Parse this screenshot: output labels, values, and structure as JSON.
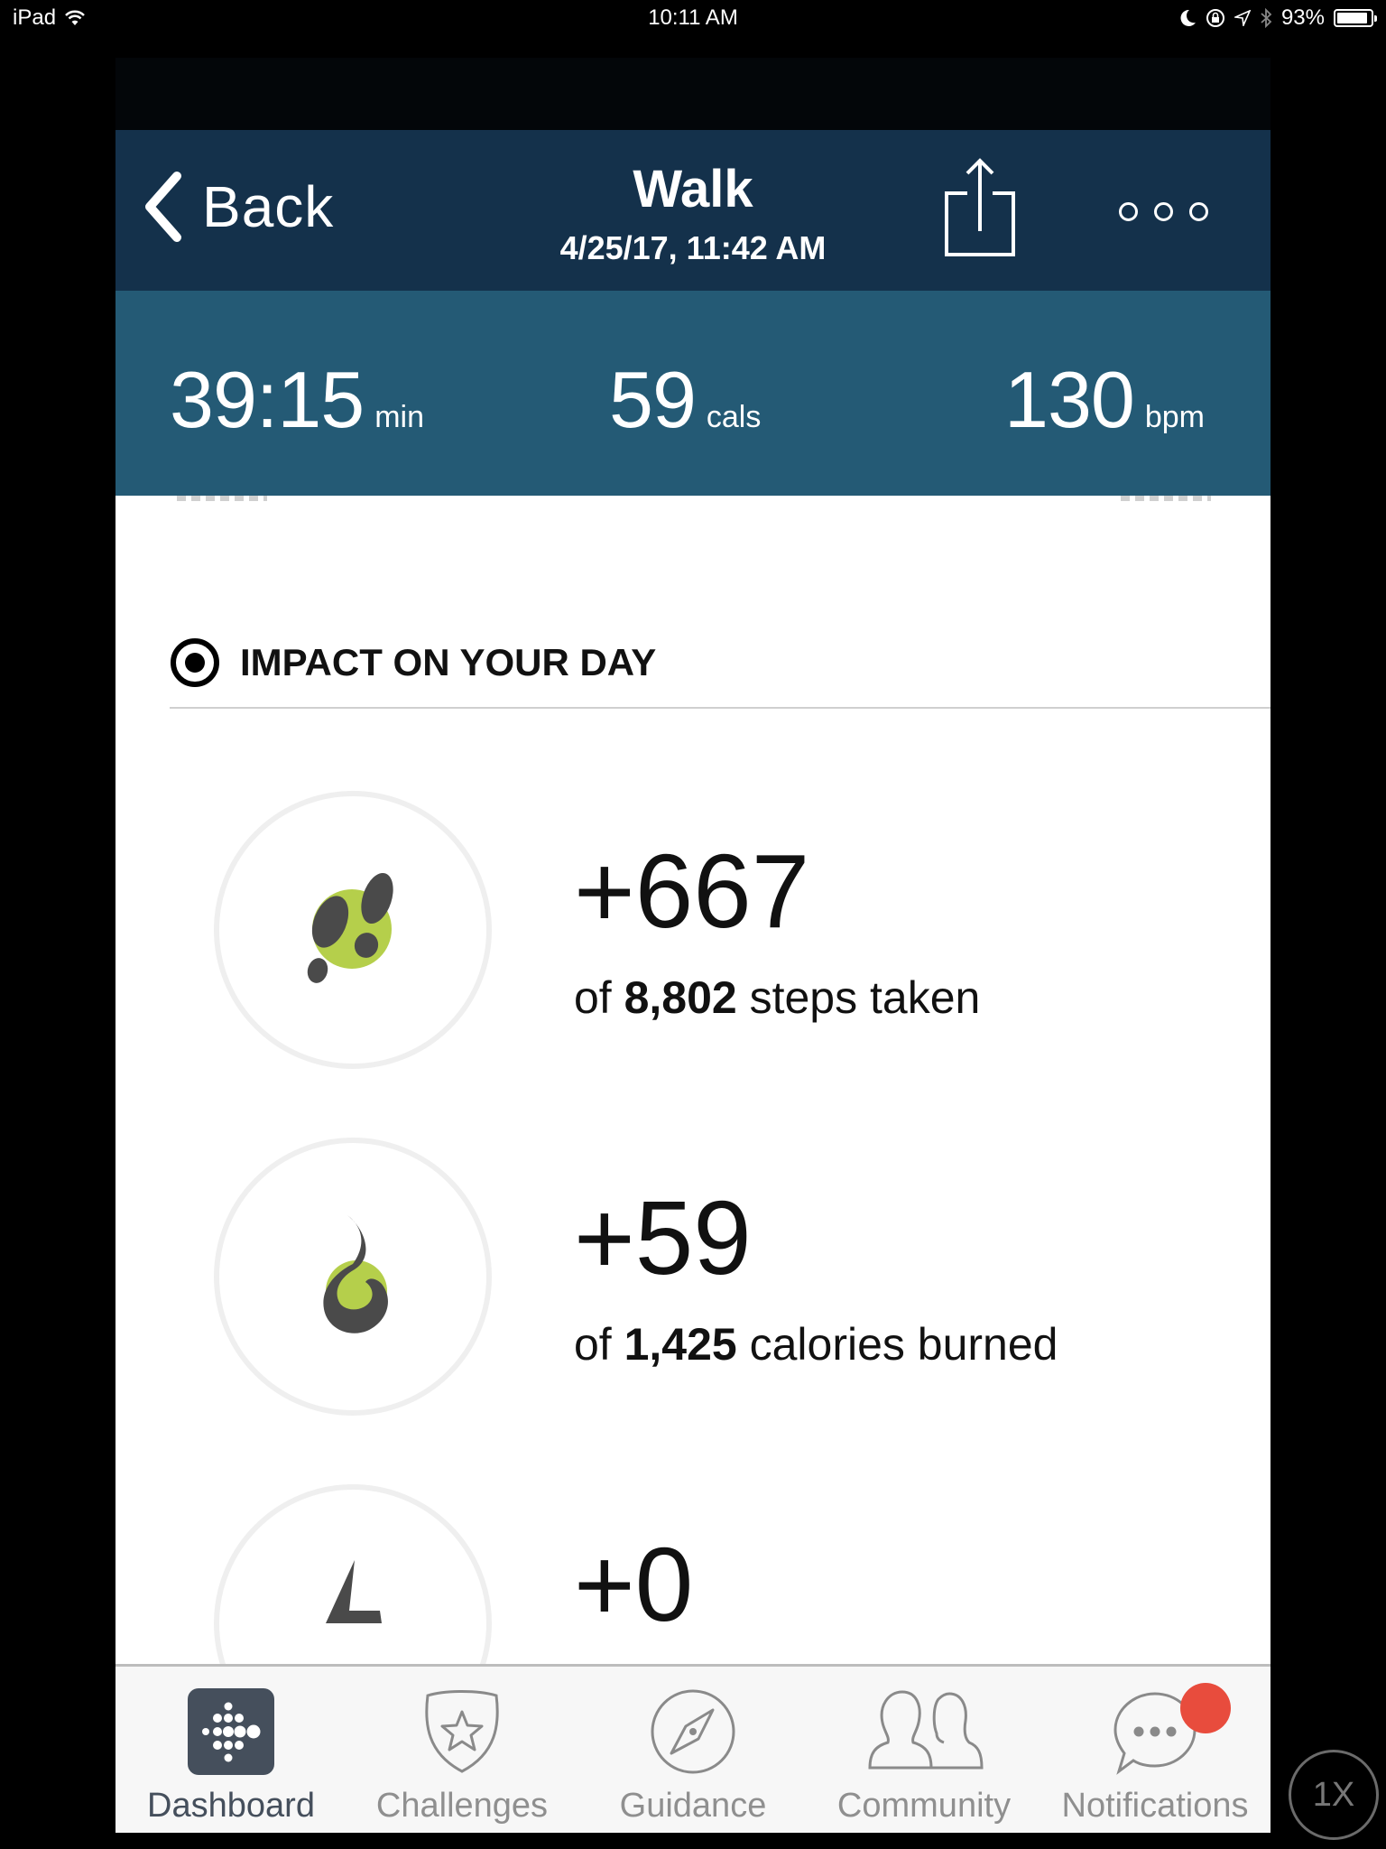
{
  "status_bar": {
    "device": "iPad",
    "time": "10:11 AM",
    "battery": "93%",
    "battery_level": 0.93
  },
  "nav": {
    "back_label": "Back",
    "title": "Walk",
    "subtitle": "4/25/17, 11:42 AM",
    "share_icon": "share-icon",
    "more_icon": "more-icon"
  },
  "stats": [
    {
      "value": "39:15",
      "unit": "min"
    },
    {
      "value": "59",
      "unit": "cals"
    },
    {
      "value": "130",
      "unit": "bpm"
    }
  ],
  "impact": {
    "title": "IMPACT ON YOUR DAY",
    "rows": [
      {
        "icon": "steps-icon",
        "delta": "+667",
        "prefix": "of ",
        "total": "8,802",
        "suffix": " steps taken"
      },
      {
        "icon": "calories-flame-icon",
        "delta": "+59",
        "prefix": "of ",
        "total": "1,425",
        "suffix": " calories burned"
      },
      {
        "icon": "active-minutes-icon",
        "delta": "+0"
      }
    ]
  },
  "tabs": [
    {
      "label": "Dashboard",
      "icon": "dashboard-icon",
      "active": true
    },
    {
      "label": "Challenges",
      "icon": "challenges-badge-icon",
      "active": false
    },
    {
      "label": "Guidance",
      "icon": "compass-icon",
      "active": false
    },
    {
      "label": "Community",
      "icon": "community-people-icon",
      "active": false
    },
    {
      "label": "Notifications",
      "icon": "chat-bubble-icon",
      "active": false
    }
  ],
  "zoom_indicator": "1X",
  "colors": {
    "nav_bg": "#14314b",
    "stats_bg": "#245a75",
    "accent_green": "#b5cf4b",
    "icon_gray": "#4a4a4a",
    "badge_red": "#e84c3d"
  }
}
